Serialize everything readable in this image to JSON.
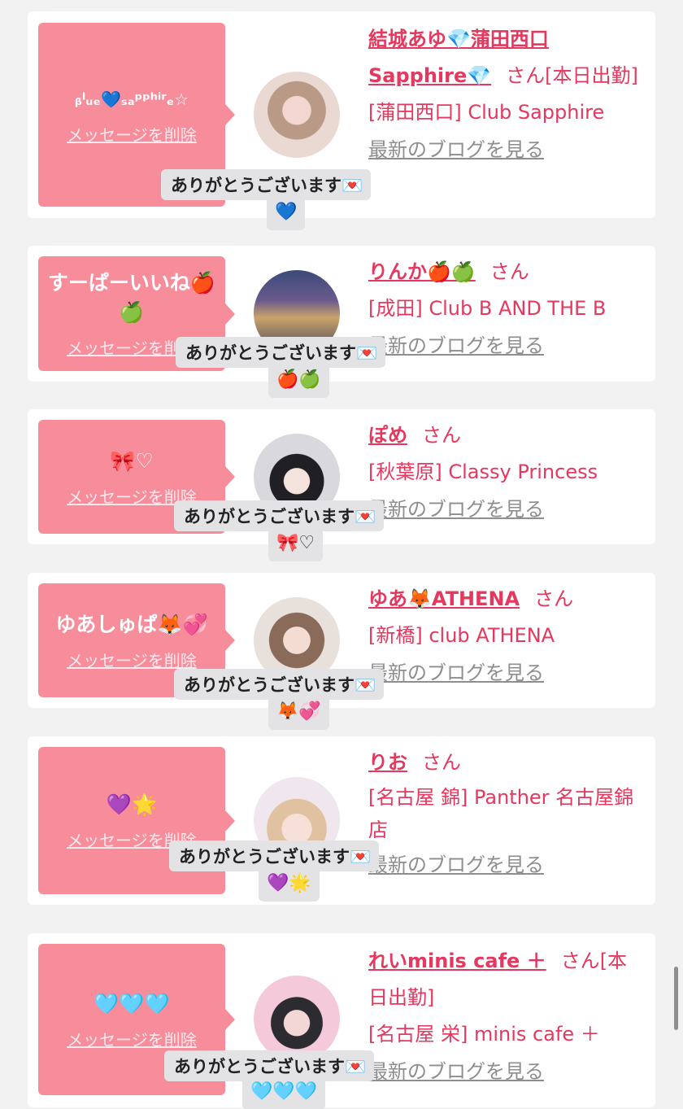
{
  "delete_label": "メッセージを削除",
  "reply_text": "ありがとうございます💌",
  "blog_label": "最新のブログを見る",
  "san_label": "さん",
  "cards": [
    {
      "message": "ᵦˡᵤₑ💙ₛₐᵖᵖʰⁱʳₑ☆",
      "name": "結城あゆ💎蒲田西口Sapphire💎",
      "suffix": "[本日出勤]",
      "shop": "[蒲田西口] Club Sapphire",
      "reply_emoji": "💙"
    },
    {
      "message": "すーぱーいいね🍎🍏",
      "name": "りんか🍎🍏",
      "suffix": "",
      "shop": "[成田] Club B AND THE B",
      "reply_emoji": "🍎🍏"
    },
    {
      "message": "🎀♡",
      "name": "ぽめ",
      "suffix": "",
      "shop": "[秋葉原] Classy Princess",
      "reply_emoji": "🎀♡"
    },
    {
      "message": "ゆあしゅぱ🦊💞",
      "name": "ゆあ🦊ATHENA",
      "suffix": "",
      "shop": "[新橋] club ATHENA",
      "reply_emoji": "🦊💞"
    },
    {
      "message": "💜🌟",
      "name": "りお",
      "suffix": "",
      "shop": "[名古屋 錦] Panther 名古屋錦店",
      "reply_emoji": "💜🌟"
    },
    {
      "message": "🩵🩵🩵",
      "name": "れいminis cafe ＋",
      "suffix": "[本日出勤]",
      "shop": "[名古屋 栄] minis cafe ＋",
      "reply_emoji": "🩵🩵🩵"
    }
  ]
}
